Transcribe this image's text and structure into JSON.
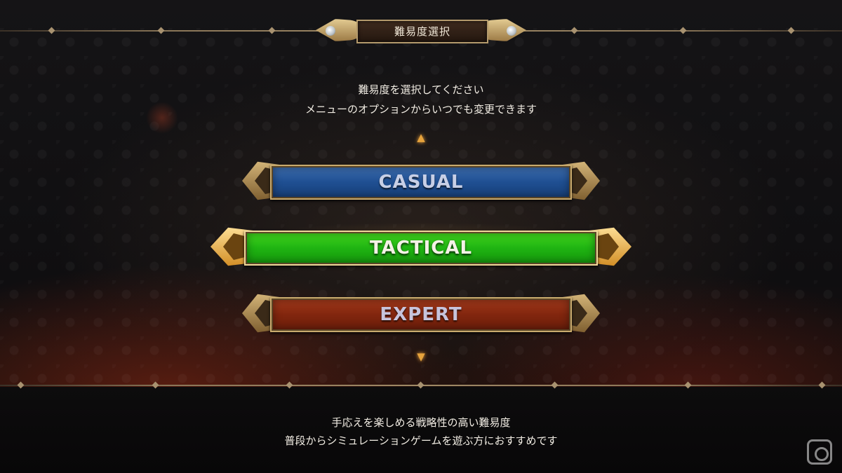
{
  "screen": {
    "title": "難易度選択"
  },
  "instructions": {
    "line1": "難易度を選択してください",
    "line2": "メニューのオプションからいつでも変更できます"
  },
  "difficulties": [
    {
      "label": "CASUAL",
      "color": "#1f4f92",
      "selected": false
    },
    {
      "label": "TACTICAL",
      "color": "#1fb412",
      "selected": true
    },
    {
      "label": "EXPERT",
      "color": "#82260e",
      "selected": false
    }
  ],
  "navigation": {
    "up_arrow": "arrow-up-icon",
    "down_arrow": "arrow-down-icon"
  },
  "description": {
    "line1": "手応えを楽しめる戦略性の高い難易度",
    "line2": "普段からシミュレーションゲームを遊ぶ方におすすめです"
  },
  "watermark": {
    "icon": "site-logo-icon"
  }
}
